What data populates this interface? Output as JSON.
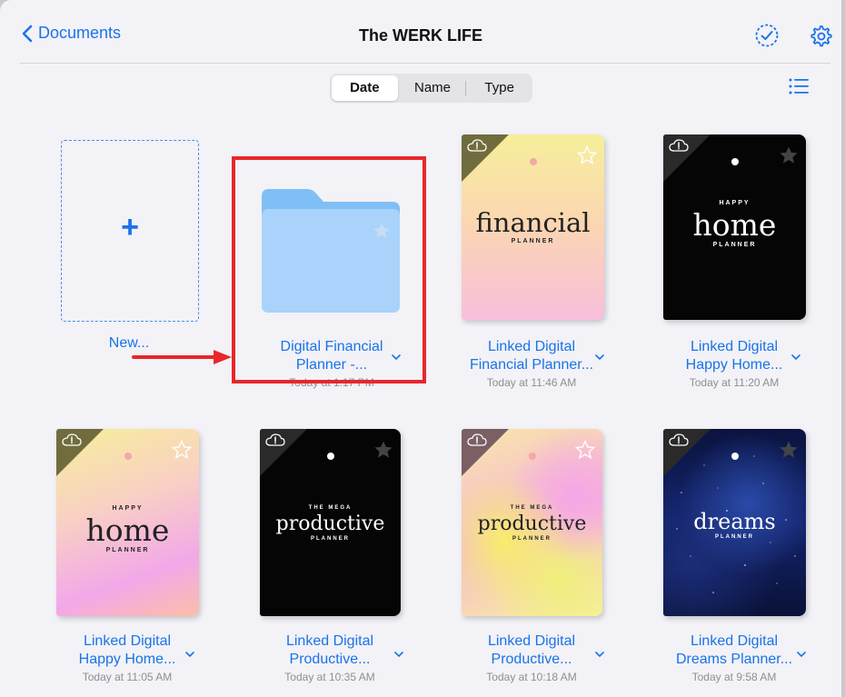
{
  "header": {
    "back_label": "Documents",
    "title": "The WERK LIFE",
    "select_icon": "checkmark-circle-icon",
    "settings_icon": "gear-icon"
  },
  "sort": {
    "options": [
      "Date",
      "Name",
      "Type"
    ],
    "selected": "Date"
  },
  "view_icon": "list-view-icon",
  "new_tile": {
    "label": "New..."
  },
  "items": [
    {
      "name": "Digital Financial Planner -...",
      "line1": "Digital Financial",
      "line2": "Planner -...",
      "date": "Today at 1:17 PM",
      "kind": "folder"
    },
    {
      "name": "Linked Digital Financial Planner...",
      "line1": "Linked Digital",
      "line2": "Financial Planner...",
      "date": "Today at 11:46 AM",
      "cover_word": "financial",
      "cover_sub": "PLANNER"
    },
    {
      "name": "Linked Digital Happy Home...",
      "line1": "Linked Digital",
      "line2": "Happy Home...",
      "date": "Today at 11:20 AM",
      "cover_top": "HAPPY",
      "cover_word": "home",
      "cover_sub": "PLANNER"
    },
    {
      "name": "Linked Digital Happy Home...",
      "line1": "Linked Digital",
      "line2": "Happy Home...",
      "date": "Today at 11:05 AM",
      "cover_top": "HAPPY",
      "cover_word": "home",
      "cover_sub": "PLANNER"
    },
    {
      "name": "Linked Digital Productive...",
      "line1": "Linked Digital",
      "line2": "Productive...",
      "date": "Today at 10:35 AM",
      "cover_top": "THE MEGA",
      "cover_word": "productive",
      "cover_sub": "PLANNER"
    },
    {
      "name": "Linked Digital Productive...",
      "line1": "Linked Digital",
      "line2": "Productive...",
      "date": "Today at 10:18 AM",
      "cover_top": "THE MEGA",
      "cover_word": "productive",
      "cover_sub": "PLANNER"
    },
    {
      "name": "Linked Digital Dreams Planner...",
      "line1": "Linked Digital",
      "line2": "Dreams Planner...",
      "date": "Today at 9:58 AM",
      "cover_word": "dreams",
      "cover_sub": "PLANNER"
    }
  ],
  "colors": {
    "accent": "#1a73e8",
    "highlight": "#e8272a",
    "folder": "#a9d3fb"
  }
}
